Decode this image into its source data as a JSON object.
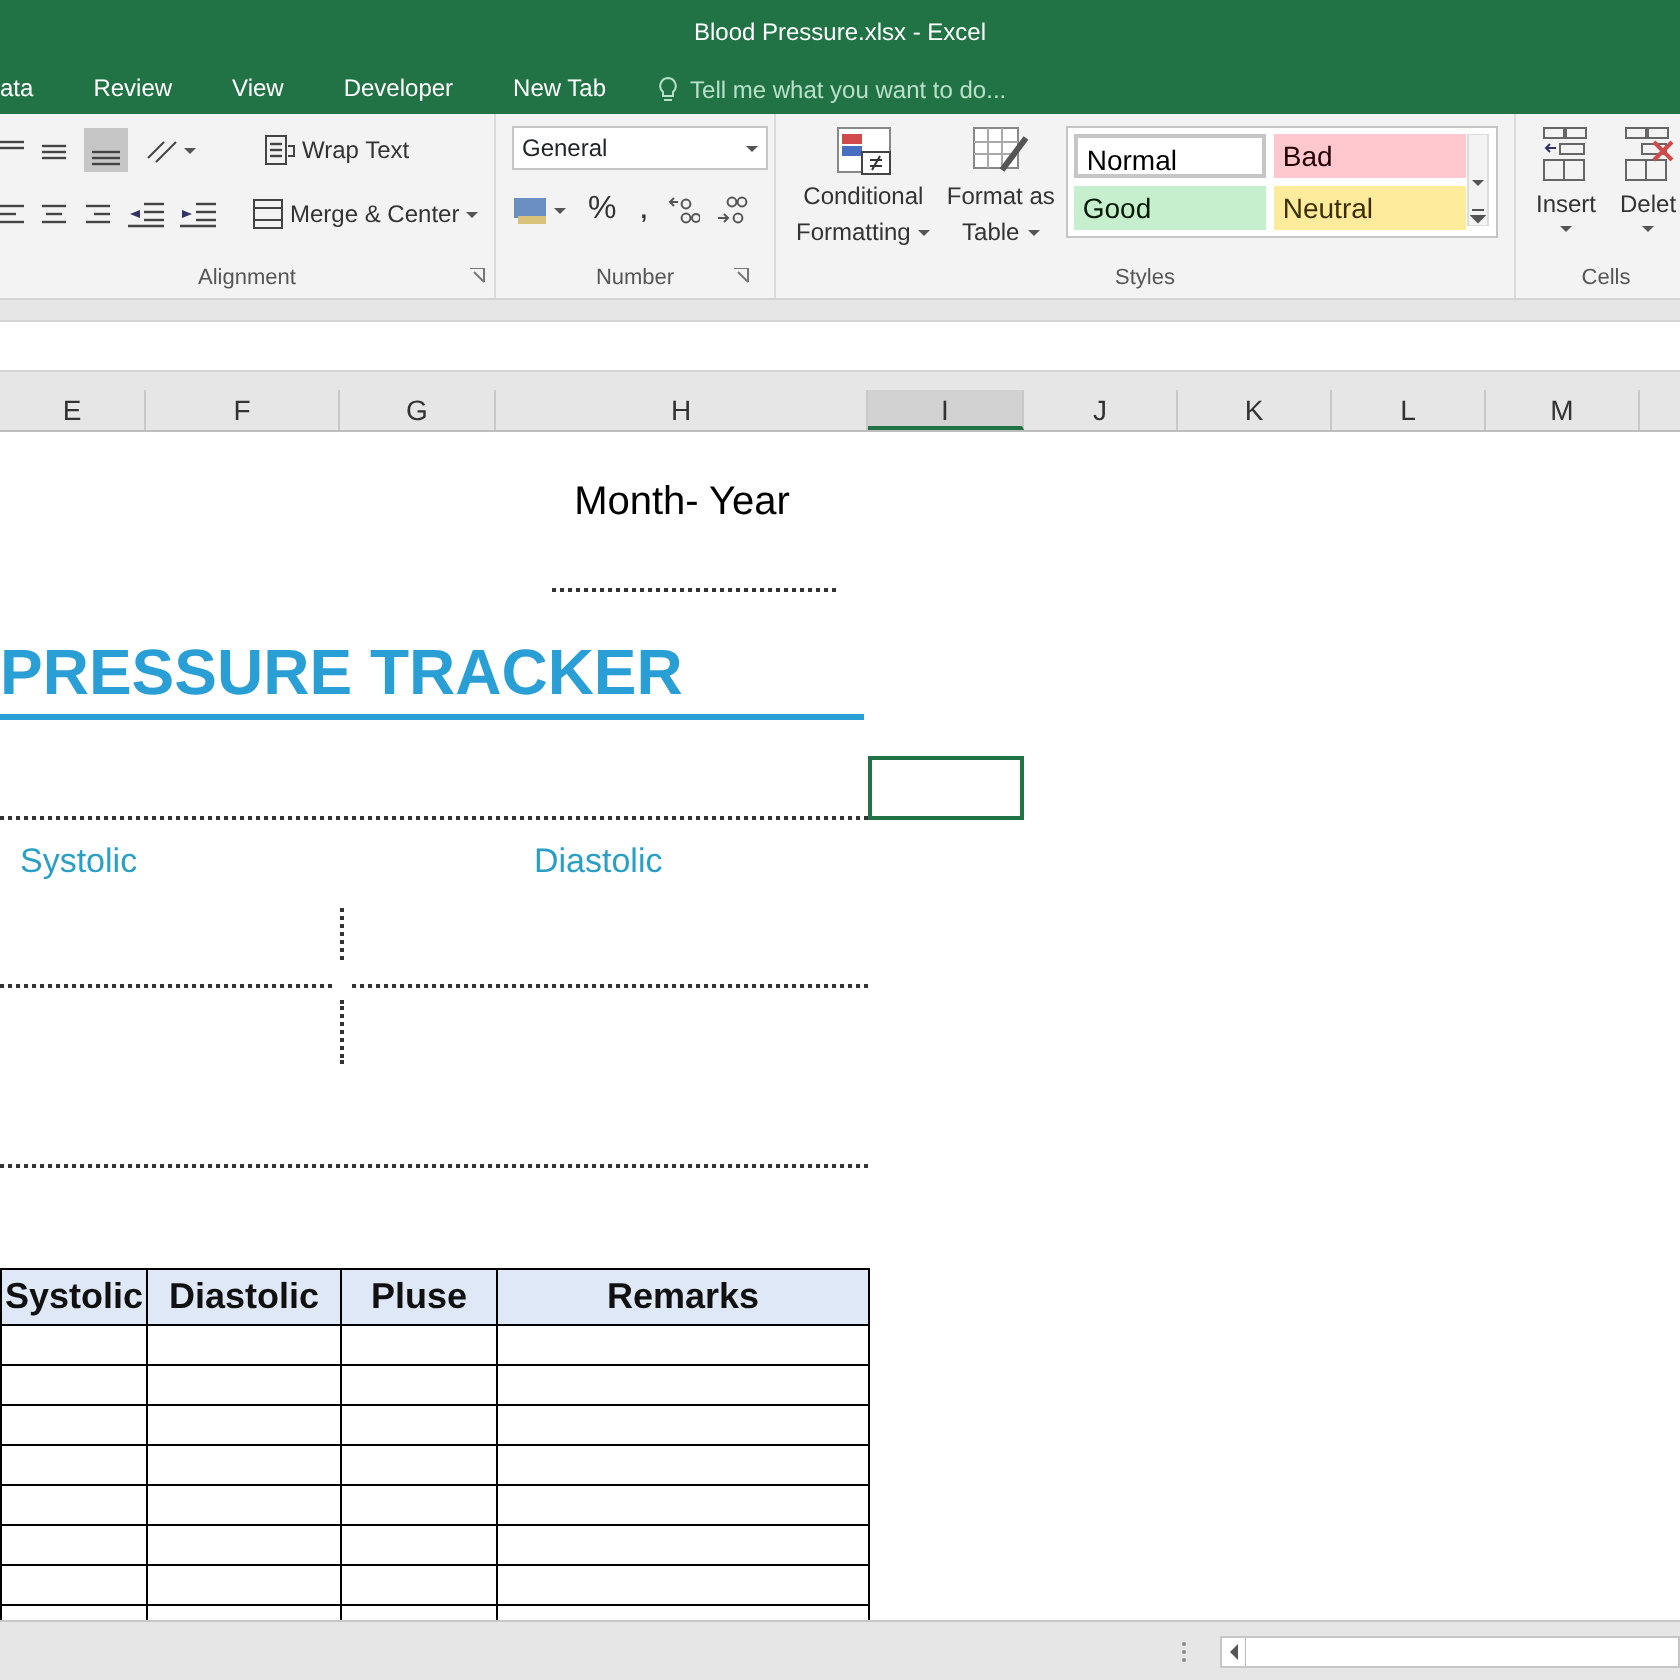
{
  "window": {
    "title": "Blood Pressure.xlsx - Excel"
  },
  "tabs": [
    {
      "label": "ata",
      "selected": false
    },
    {
      "label": "Review",
      "selected": false
    },
    {
      "label": "View",
      "selected": false
    },
    {
      "label": "Developer",
      "selected": false
    },
    {
      "label": "New Tab",
      "selected": false
    }
  ],
  "tell_me": {
    "placeholder": "Tell me what you want to do..."
  },
  "ribbon": {
    "alignment": {
      "wrap_text": "Wrap Text",
      "merge_center": "Merge & Center",
      "label": "Alignment"
    },
    "number": {
      "format": "General",
      "percent": "%",
      "comma": ",",
      "label": "Number"
    },
    "styles": {
      "buttons": [
        {
          "lines": [
            "Conditional",
            "Formatting"
          ]
        },
        {
          "lines": [
            "Format as",
            "Table"
          ]
        }
      ],
      "cell_styles": [
        {
          "label": "Normal",
          "color": "#ffffff"
        },
        {
          "label": "Bad",
          "color": "#ffc7ce"
        },
        {
          "label": "Good",
          "color": "#c6efce"
        },
        {
          "label": "Neutral",
          "color": "#ffeb9c"
        }
      ],
      "label": "Styles"
    },
    "cells": {
      "buttons": [
        {
          "label": "Insert"
        },
        {
          "label": "Delet"
        }
      ],
      "label": "Cells"
    }
  },
  "column_headers": [
    {
      "label": "E",
      "selected": false
    },
    {
      "label": "F",
      "selected": false
    },
    {
      "label": "G",
      "selected": false
    },
    {
      "label": "H",
      "selected": false
    },
    {
      "label": "I",
      "selected": true
    },
    {
      "label": "J",
      "selected": false
    },
    {
      "label": "K",
      "selected": false
    },
    {
      "label": "L",
      "selected": false
    },
    {
      "label": "M",
      "selected": false
    }
  ],
  "sheet": {
    "month_year": "Month- Year",
    "title": "PRESSURE TRACKER",
    "systolic": "Systolic",
    "diastolic": "Diastolic",
    "table": {
      "columns": [
        "Systolic",
        "Diastolic",
        "Pluse",
        "Remarks"
      ]
    }
  }
}
